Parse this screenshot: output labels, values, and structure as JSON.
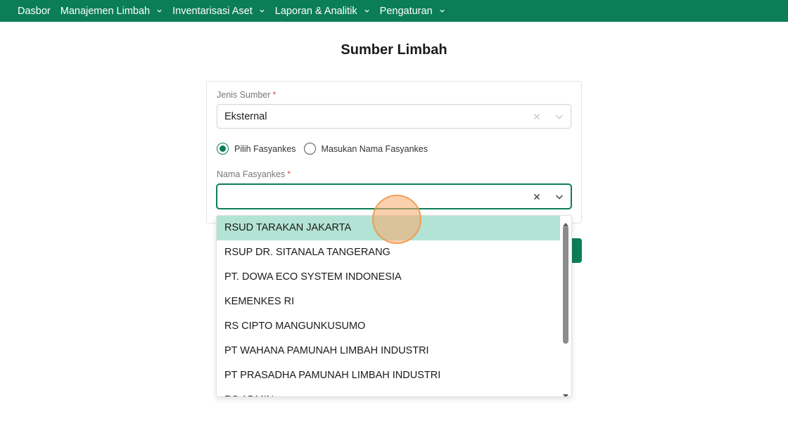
{
  "nav": {
    "items": [
      {
        "label": "Dasbor",
        "has_dropdown": false
      },
      {
        "label": "Manajemen Limbah",
        "has_dropdown": true
      },
      {
        "label": "Inventarisasi Aset",
        "has_dropdown": true
      },
      {
        "label": "Laporan & Analitik",
        "has_dropdown": true
      },
      {
        "label": "Pengaturan",
        "has_dropdown": true
      }
    ]
  },
  "page": {
    "title": "Sumber Limbah"
  },
  "form": {
    "jenis_sumber": {
      "label": "Jenis Sumber",
      "required_mark": "*",
      "value": "Eksternal"
    },
    "radio": {
      "option1": {
        "label": "Pilih Fasyankes",
        "checked": true
      },
      "option2": {
        "label": "Masukan Nama Fasyankes",
        "checked": false
      }
    },
    "nama_fasyankes": {
      "label": "Nama Fasyankes",
      "required_mark": "*",
      "value": ""
    }
  },
  "dropdown": {
    "options": [
      "RSUD TARAKAN JAKARTA",
      "RSUP DR. SITANALA TANGERANG",
      "PT. DOWA ECO SYSTEM INDONESIA",
      "KEMENKES RI",
      "RS CIPTO MANGUNKUSUMO",
      "PT WAHANA PAMUNAH LIMBAH INDUSTRI",
      "PT PRASADHA PAMUNAH LIMBAH INDUSTRI",
      "RS ADMIN"
    ],
    "highlighted_index": 0
  },
  "colors": {
    "brand": "#0c7e57",
    "highlight": "#b3e3d4",
    "required": "#d9534f"
  }
}
